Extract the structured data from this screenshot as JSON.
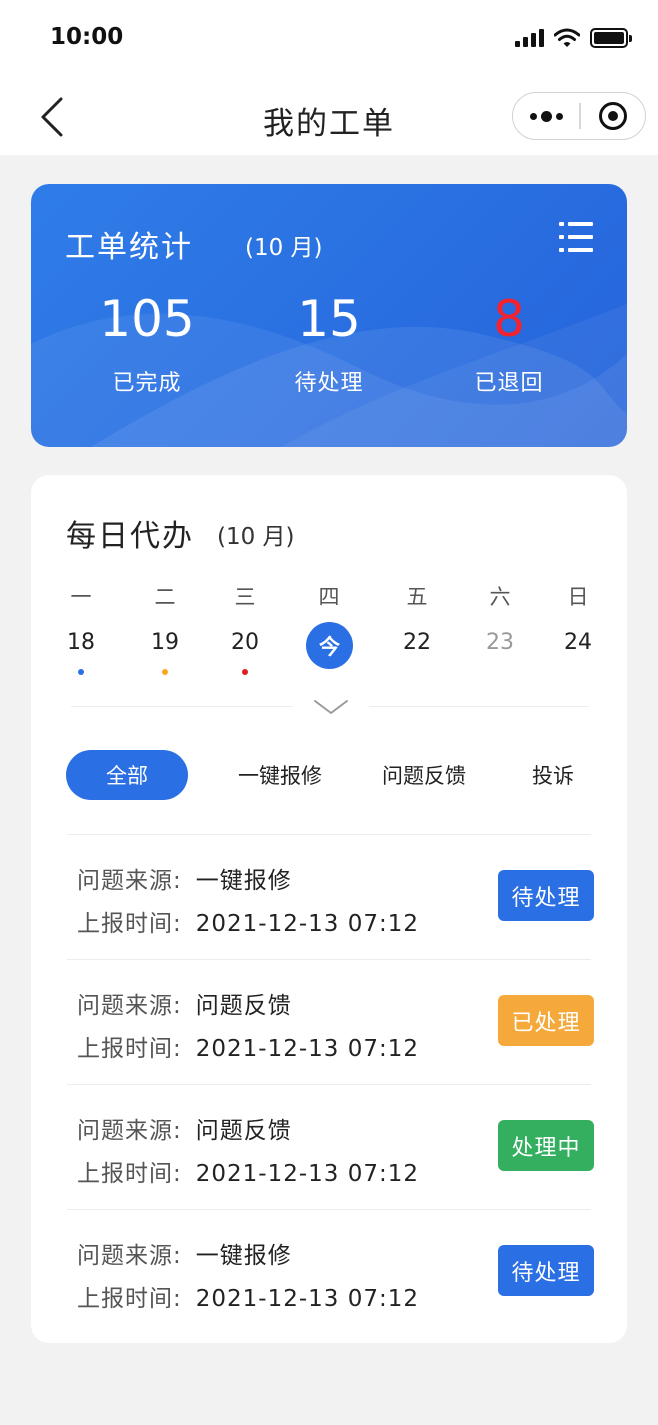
{
  "status_bar": {
    "time": "10:00"
  },
  "nav": {
    "title": "我的工单"
  },
  "stats": {
    "title": "工单统计",
    "month": "(10 月)",
    "items": [
      {
        "value": "105",
        "label": "已完成",
        "color": "#ffffff"
      },
      {
        "value": "15",
        "label": "待处理",
        "color": "#ffffff"
      },
      {
        "value": "8",
        "label": "已退回",
        "color": "#f5222d"
      }
    ]
  },
  "todo": {
    "title": "每日代办",
    "month": "(10 月)",
    "weekdays": [
      "一",
      "二",
      "三",
      "四",
      "五",
      "六",
      "日"
    ],
    "days": [
      {
        "label": "18",
        "dot": "#2a6fe4"
      },
      {
        "label": "19",
        "dot": "#f5a623"
      },
      {
        "label": "20",
        "dot": "#e02020"
      },
      {
        "label": "今",
        "today": true
      },
      {
        "label": "22"
      },
      {
        "label": "23",
        "muted": true
      },
      {
        "label": "24"
      }
    ]
  },
  "tabs": [
    {
      "label": "全部",
      "active": true
    },
    {
      "label": "一键报修"
    },
    {
      "label": "问题反馈"
    },
    {
      "label": "投诉"
    }
  ],
  "records": [
    {
      "source_label": "问题来源:",
      "source": "一键报修",
      "time_label": "上报时间:",
      "time": "2021-12-13 07:12",
      "status": "待处理",
      "status_color": "#2a6fe4"
    },
    {
      "source_label": "问题来源:",
      "source": "问题反馈",
      "time_label": "上报时间:",
      "time": "2021-12-13 07:12",
      "status": "已处理",
      "status_color": "#f5a93a"
    },
    {
      "source_label": "问题来源:",
      "source": "问题反馈",
      "time_label": "上报时间:",
      "time": "2021-12-13 07:12",
      "status": "处理中",
      "status_color": "#34ae5f"
    },
    {
      "source_label": "问题来源:",
      "source": "一键报修",
      "time_label": "上报时间:",
      "time": "2021-12-13 07:12",
      "status": "待处理",
      "status_color": "#2a6fe4"
    }
  ]
}
